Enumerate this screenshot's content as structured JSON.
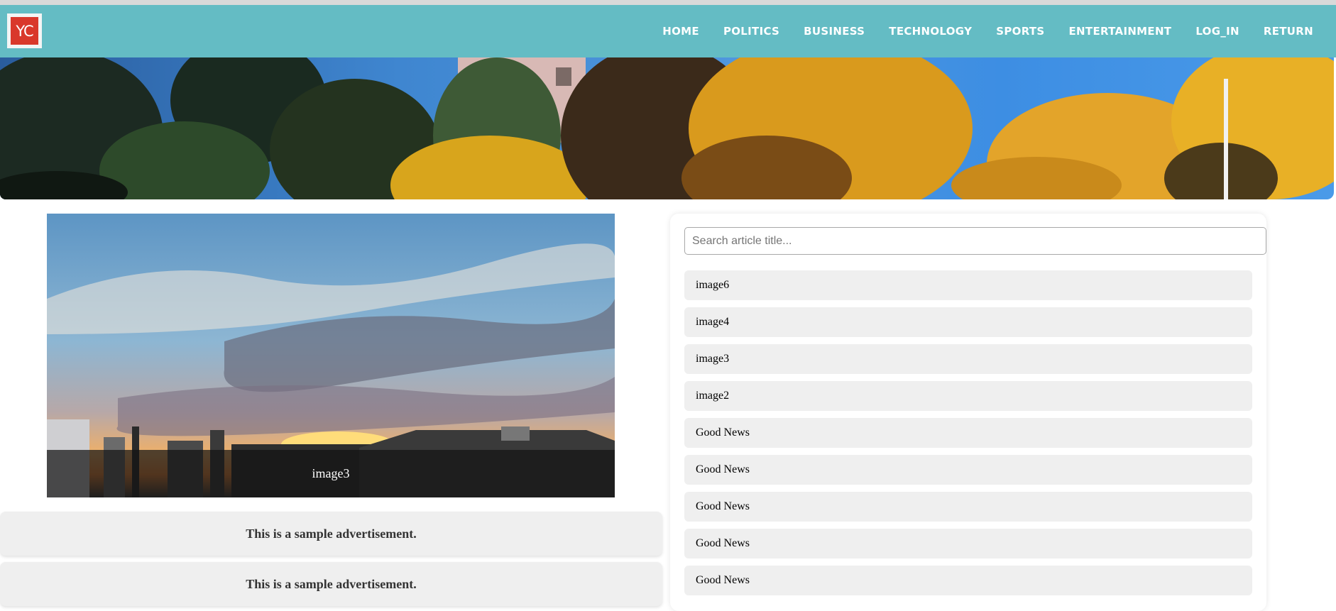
{
  "brand": {
    "logo_text": "YC"
  },
  "nav": {
    "items": [
      {
        "label": "HOME"
      },
      {
        "label": "POLITICS"
      },
      {
        "label": "BUSINESS"
      },
      {
        "label": "TECHNOLOGY"
      },
      {
        "label": "SPORTS"
      },
      {
        "label": "ENTERTAINMENT"
      },
      {
        "label": "LOG_IN"
      },
      {
        "label": "RETURN"
      }
    ]
  },
  "slideshow": {
    "caption": "image3"
  },
  "ads": [
    {
      "text": "This is a sample advertisement."
    },
    {
      "text": "This is a sample advertisement."
    }
  ],
  "search": {
    "placeholder": "Search article title...",
    "value": ""
  },
  "articles": [
    {
      "title": "image6"
    },
    {
      "title": "image4"
    },
    {
      "title": "image3"
    },
    {
      "title": "image2"
    },
    {
      "title": "Good News"
    },
    {
      "title": "Good News"
    },
    {
      "title": "Good News"
    },
    {
      "title": "Good News"
    },
    {
      "title": "Good News"
    }
  ],
  "colors": {
    "navbar": "#64bcc4",
    "logo_red": "#d9382b",
    "item_background": "#efefef"
  }
}
